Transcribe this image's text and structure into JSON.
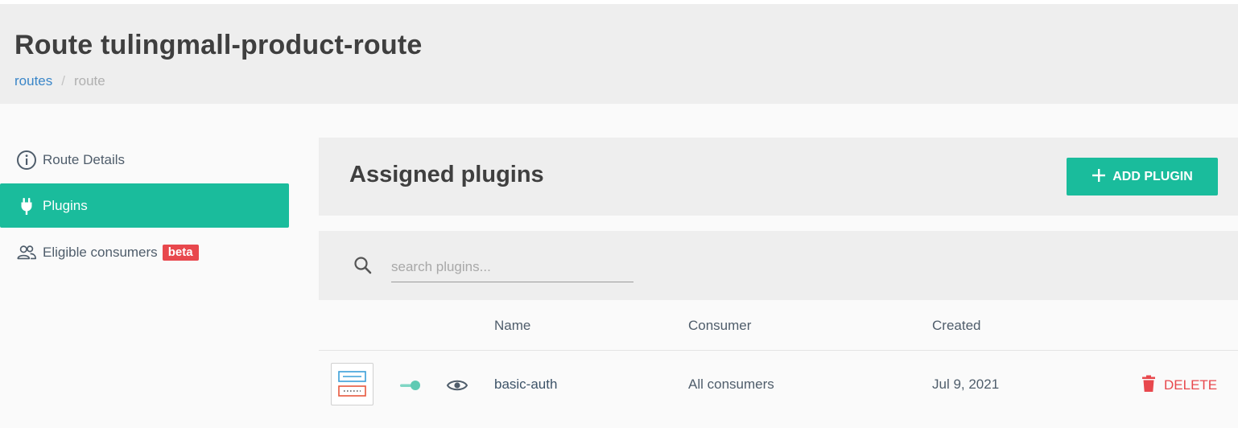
{
  "header": {
    "title": "Route tulingmall-product-route",
    "breadcrumb": {
      "link": "routes",
      "separator": "/",
      "current": "route"
    }
  },
  "sidebar": {
    "items": [
      {
        "label": "Route Details",
        "icon": "info-circle-icon",
        "active": false
      },
      {
        "label": "Plugins",
        "icon": "plug-icon",
        "active": true
      },
      {
        "label": "Eligible consumers",
        "icon": "users-icon",
        "active": false,
        "badge": "beta"
      }
    ]
  },
  "plugins": {
    "title": "Assigned plugins",
    "add_button": {
      "icon": "plus-icon",
      "label": "ADD PLUGIN"
    },
    "search": {
      "placeholder": "search plugins..."
    },
    "table": {
      "columns": [
        "Name",
        "Consumer",
        "Created"
      ],
      "rows": [
        {
          "name": "basic-auth",
          "consumer": "All consumers",
          "created": "Jul 9, 2021",
          "enabled": true,
          "delete_label": "DELETE"
        }
      ]
    }
  },
  "colors": {
    "accent": "#1abc9c",
    "danger": "#e8484d",
    "link": "#3a86c8",
    "header_bg": "#eeeeee"
  }
}
